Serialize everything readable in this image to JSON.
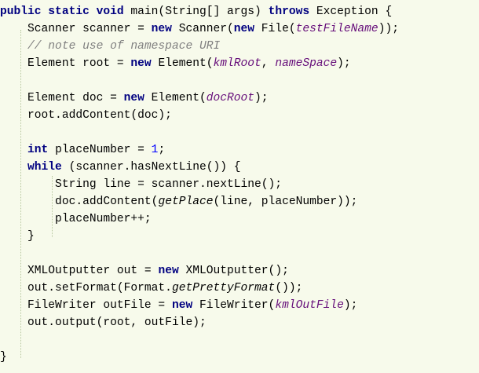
{
  "editor": {
    "lines": [
      [
        [
          "kw",
          "public static void "
        ],
        [
          "t",
          "main(String[] args) "
        ],
        [
          "kw",
          "throws "
        ],
        [
          "t",
          "Exception {"
        ]
      ],
      [
        [
          "t",
          "    Scanner scanner = "
        ],
        [
          "kw",
          "new "
        ],
        [
          "t",
          "Scanner("
        ],
        [
          "kw",
          "new "
        ],
        [
          "t",
          "File("
        ],
        [
          "fld",
          "testFileName"
        ],
        [
          "t",
          "));"
        ]
      ],
      [
        [
          "cmt",
          "    // note use of namespace URI"
        ]
      ],
      [
        [
          "t",
          "    Element root = "
        ],
        [
          "kw",
          "new "
        ],
        [
          "t",
          "Element("
        ],
        [
          "fld",
          "kmlRoot"
        ],
        [
          "t",
          ", "
        ],
        [
          "fld",
          "nameSpace"
        ],
        [
          "t",
          ");"
        ]
      ],
      [],
      [
        [
          "t",
          "    Element doc = "
        ],
        [
          "kw",
          "new "
        ],
        [
          "t",
          "Element("
        ],
        [
          "fld",
          "docRoot"
        ],
        [
          "t",
          ");"
        ]
      ],
      [
        [
          "t",
          "    root.addContent(doc);"
        ]
      ],
      [],
      [
        [
          "t",
          "    "
        ],
        [
          "kw",
          "int "
        ],
        [
          "t",
          "placeNumber = "
        ],
        [
          "num",
          "1"
        ],
        [
          "t",
          ";"
        ]
      ],
      [
        [
          "t",
          "    "
        ],
        [
          "kw",
          "while "
        ],
        [
          "t",
          "(scanner.hasNextLine()) {"
        ]
      ],
      [
        [
          "t",
          "        String line = scanner.nextLine();"
        ]
      ],
      [
        [
          "t",
          "        doc.addContent("
        ],
        [
          "mth",
          "getPlace"
        ],
        [
          "t",
          "(line, placeNumber));"
        ]
      ],
      [
        [
          "t",
          "        placeNumber++;"
        ]
      ],
      [
        [
          "t",
          "    }"
        ]
      ],
      [],
      [
        [
          "t",
          "    XMLOutputter out = "
        ],
        [
          "kw",
          "new "
        ],
        [
          "t",
          "XMLOutputter();"
        ]
      ],
      [
        [
          "t",
          "    out.setFormat(Format."
        ],
        [
          "mth",
          "getPrettyFormat"
        ],
        [
          "t",
          "());"
        ]
      ],
      [
        [
          "t",
          "    FileWriter outFile = "
        ],
        [
          "kw",
          "new "
        ],
        [
          "t",
          "FileWriter("
        ],
        [
          "fld",
          "kmlOutFile"
        ],
        [
          "t",
          ");"
        ]
      ],
      [
        [
          "t",
          "    out.output(root, outFile);"
        ]
      ],
      [],
      [
        [
          "t",
          "}"
        ]
      ]
    ]
  },
  "colors": {
    "background": "#f7faeb",
    "keyword": "#000080",
    "field": "#660e7a",
    "comment": "#808080",
    "number": "#0000ff"
  }
}
